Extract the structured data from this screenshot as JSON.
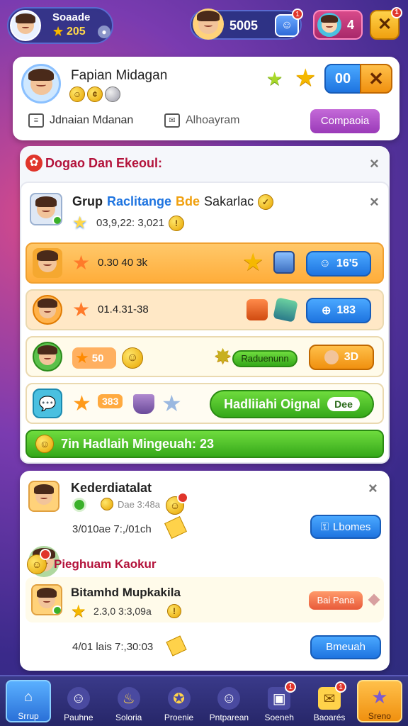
{
  "topbar": {
    "player_name": "Soaade",
    "player_stars": "205",
    "currency_value": "5005",
    "currency_badge": "1",
    "mail_value": "4",
    "close_badge": "1"
  },
  "profile": {
    "name": "Fapian Midagan",
    "score": "00",
    "info_left": "Jdnaian Mdanan",
    "info_right": "Alhoayram",
    "action_button": "Compaoia"
  },
  "panel": {
    "title": "Dogao Dan Ekeoul:"
  },
  "group_card": {
    "title_a": "Grup",
    "title_b": "Raclitange",
    "title_c": "Bde",
    "title_d": "Sakarlac",
    "subtitle": "03,9,22: 3,021",
    "rows": [
      {
        "label": "0.30 40 3k",
        "button": "16'5",
        "color": "#ffb347"
      },
      {
        "label": "01.4.31-38",
        "button": "183",
        "color": "#ffe6c2"
      },
      {
        "label": "50",
        "button_green": "Raduenunn",
        "button_orange": "3D",
        "color": "#fff6e0"
      },
      {
        "label": "383",
        "button_claim": "Hadliiahi Oignal",
        "button_claim_tag": "Dee",
        "color": "#fff8e8"
      }
    ],
    "footer": "7in Hadlaih Mingeuah: 23"
  },
  "friends_card": {
    "name": "Kederdiatalat",
    "meta": "Dae 3:48a",
    "time": "3/010ae 7:,/01ch",
    "button": "Lbomes",
    "section_title": "Pieghuam Kaokur",
    "sub_name": "Bitamhd Mupkakila",
    "sub_meta": "2.3,0 3:3,09a",
    "sub_tag": "Bai Pana",
    "sub_time": "4/01 lais 7:,30:03",
    "sub_button": "Bmeuah"
  },
  "nav": [
    {
      "label": "Srrup",
      "icon": "home-icon"
    },
    {
      "label": "Pauhne",
      "icon": "profile-icon"
    },
    {
      "label": "Soloria",
      "icon": "torch-icon"
    },
    {
      "label": "Proenie",
      "icon": "medal-icon"
    },
    {
      "label": "Pntparean",
      "icon": "chat-icon"
    },
    {
      "label": "Soeneh",
      "icon": "tv-icon",
      "badge": "1"
    },
    {
      "label": "Baoarés",
      "icon": "ticket-icon",
      "badge": "1"
    },
    {
      "label": "Sreno",
      "icon": "star-icon"
    }
  ],
  "colors": {
    "accent_orange": "#f0900f",
    "accent_blue": "#1e74e0",
    "accent_green": "#35a81a",
    "title_red": "#b3123a",
    "nav_bg": "#2f2f7a"
  }
}
